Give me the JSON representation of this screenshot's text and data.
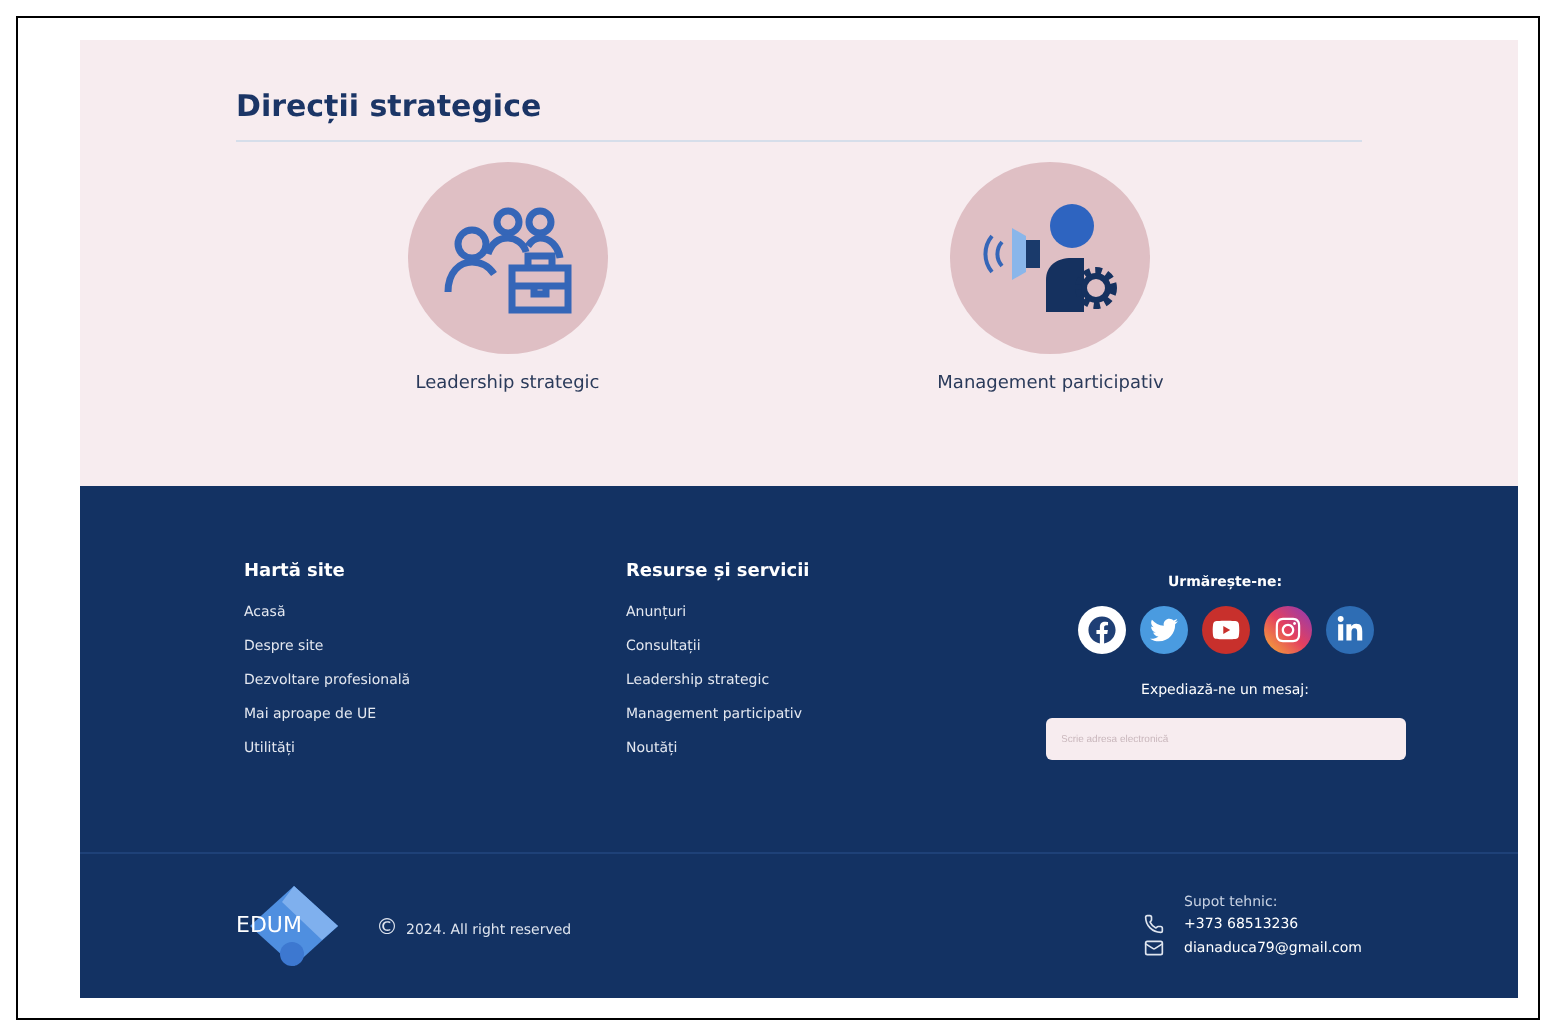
{
  "section": {
    "title": "Direcții strategice",
    "items": [
      {
        "kind": "leadership",
        "label": "Leadership strategic"
      },
      {
        "kind": "management",
        "label": "Management participativ"
      }
    ]
  },
  "footer": {
    "columns": [
      {
        "heading": "Hartă site",
        "links": [
          "Acasă",
          "Despre site",
          "Dezvoltare profesională",
          "Mai aproape de UE",
          "Utilități"
        ]
      },
      {
        "heading": "Resurse și servicii",
        "links": [
          "Anunțuri",
          "Consultații",
          "Leadership strategic",
          "Management participativ",
          "Noutăți"
        ]
      }
    ],
    "follow": {
      "heading": "Urmărește-ne:",
      "socials": [
        {
          "kind": "facebook"
        },
        {
          "kind": "twitter"
        },
        {
          "kind": "youtube"
        },
        {
          "kind": "instagram"
        },
        {
          "kind": "linkedin"
        }
      ]
    },
    "message": {
      "heading": "Expediază-ne un mesaj:",
      "placeholder": "Scrie adresa electronică"
    },
    "logo": {
      "text": "EDUM"
    },
    "copyright": {
      "symbol": "©",
      "text": "2024. All right reserved"
    },
    "support": {
      "heading": "Supot tehnic:",
      "phone": "+373 68513236",
      "email": "dianaduca79@gmail.com"
    }
  }
}
